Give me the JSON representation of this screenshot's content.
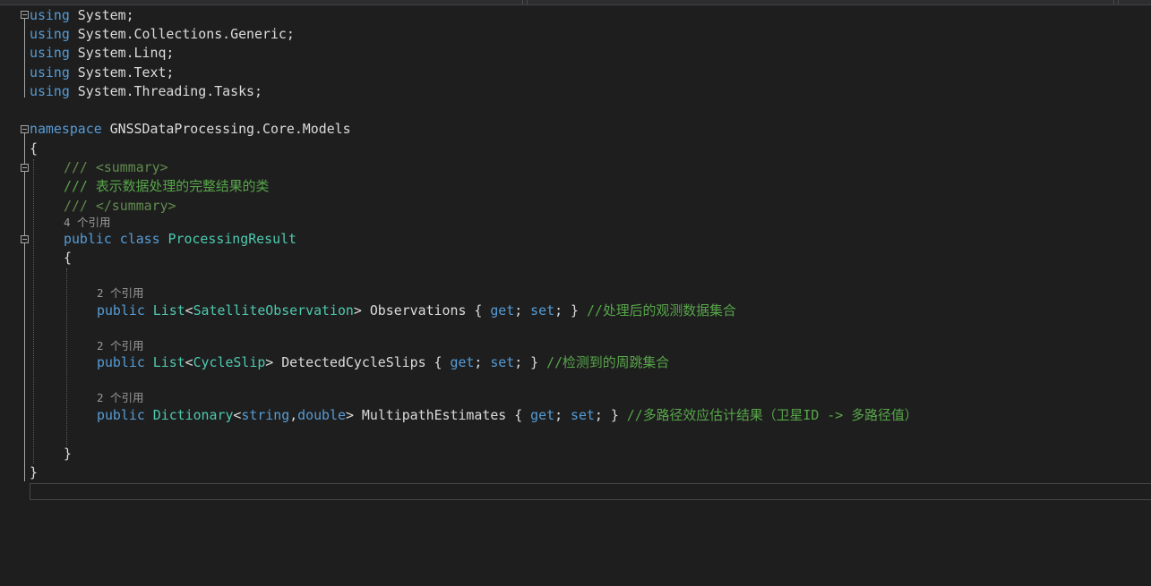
{
  "code": {
    "using1_kw": "using",
    "using1_ns": " System;",
    "using2_kw": "using",
    "using2_ns": " System.Collections.Generic;",
    "using3_kw": "using",
    "using3_ns": " System.Linq;",
    "using4_kw": "using",
    "using4_ns": " System.Text;",
    "using5_kw": "using",
    "using5_ns": " System.Threading.Tasks;",
    "ns_kw": "namespace",
    "ns_name": " GNSSDataProcessing.Core.Models",
    "ns_open": "{",
    "doc1_slashes": "/// ",
    "doc1_tag": "<summary>",
    "doc2_text": "/// 表示数据处理的完整结果的类",
    "doc3_slashes": "/// ",
    "doc3_tag": "</summary>",
    "class_refs": "4 个引用",
    "class_kw1": "public",
    "class_kw2": " class",
    "class_name": " ProcessingResult",
    "class_open": "{",
    "p1_refs": "2 个引用",
    "p1_public": "public",
    "p1_type": " List",
    "p1_lt": "<",
    "p1_generic": "SatelliteObservation",
    "p1_rest": "> Observations { ",
    "p1_get": "get",
    "p1_semi1": "; ",
    "p1_set": "set",
    "p1_close": "; } ",
    "p1_comment": "//处理后的观测数据集合",
    "p2_refs": "2 个引用",
    "p2_public": "public",
    "p2_type": " List",
    "p2_lt": "<",
    "p2_generic": "CycleSlip",
    "p2_rest": "> DetectedCycleSlips { ",
    "p2_get": "get",
    "p2_semi1": "; ",
    "p2_set": "set",
    "p2_close": "; } ",
    "p2_comment": "//检测到的周跳集合",
    "p3_refs": "2 个引用",
    "p3_public": "public",
    "p3_type": " Dictionary",
    "p3_lt": "<",
    "p3_t1": "string",
    "p3_comma": ",",
    "p3_t2": "double",
    "p3_rest": "> MultipathEstimates { ",
    "p3_get": "get",
    "p3_semi1": "; ",
    "p3_set": "set",
    "p3_close": "; } ",
    "p3_comment": "//多路径效应估计结果（卫星ID -> 多路径值）",
    "class_close": "}",
    "ns_close": "}"
  },
  "colors": {
    "background": "#1e1e1e",
    "keyword": "#569cd6",
    "type": "#4ec9b0",
    "plain": "#dcdcdc",
    "comment": "#57a64a",
    "codelens": "#999999"
  }
}
